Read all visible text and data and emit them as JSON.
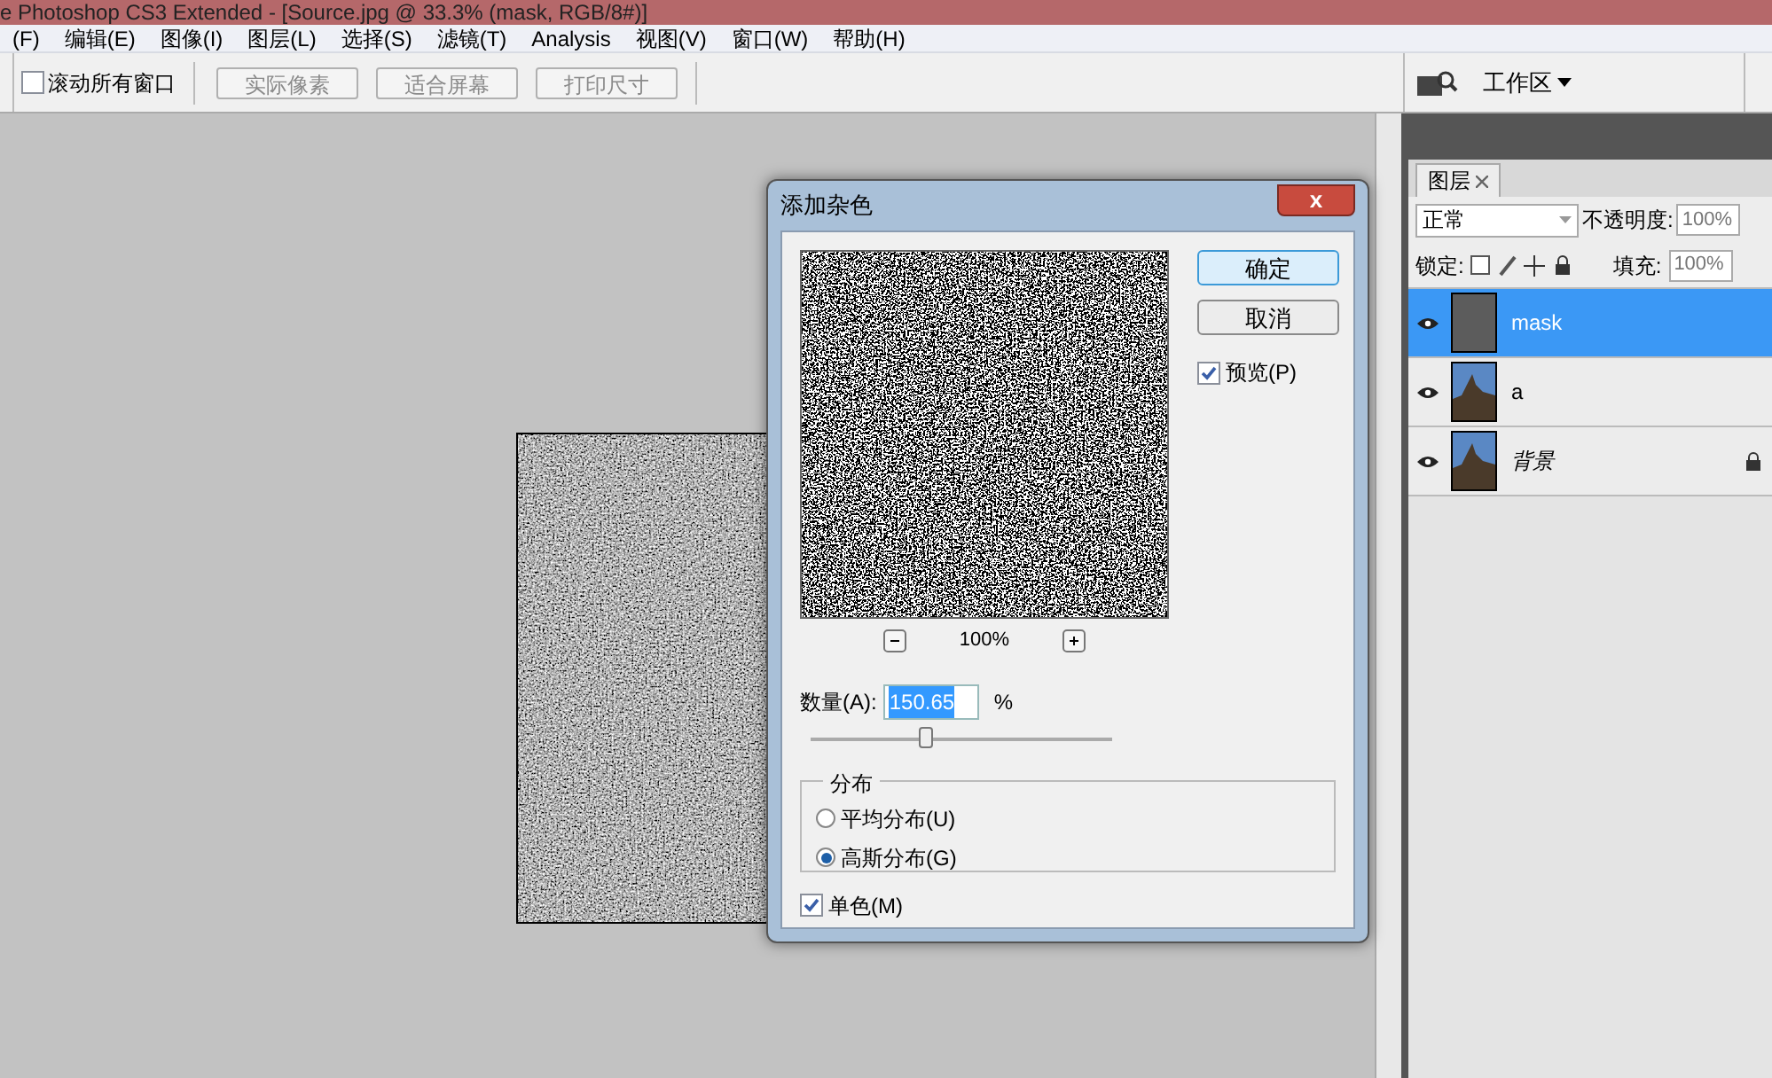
{
  "window": {
    "title": "e Photoshop CS3 Extended - [Source.jpg @ 33.3% (mask, RGB/8#)]"
  },
  "menu": [
    "(F)",
    "编辑(E)",
    "图像(I)",
    "图层(L)",
    "选择(S)",
    "滤镜(T)",
    "Analysis",
    "视图(V)",
    "窗口(W)",
    "帮助(H)"
  ],
  "options_bar": {
    "scroll_all": {
      "label": "滚动所有窗口",
      "checked": false
    },
    "buttons": [
      {
        "label": "实际像素",
        "disabled": true
      },
      {
        "label": "适合屏幕",
        "disabled": true
      },
      {
        "label": "打印尺寸",
        "disabled": true
      }
    ],
    "workspace": "工作区"
  },
  "dialog": {
    "title": "添加杂色",
    "close": "x",
    "ok": "确定",
    "cancel": "取消",
    "preview": {
      "label": "预览(P)",
      "checked": true
    },
    "zoom": "100%",
    "amount_label": "数量(A):",
    "amount": "150.65",
    "unit": "%",
    "amount_slider": {
      "level": 0.38
    },
    "distribution": {
      "title": "分布",
      "options": [
        {
          "label": "平均分布(U)",
          "selected": false
        },
        {
          "label": "高斯分布(G)",
          "selected": true
        }
      ]
    },
    "mono": {
      "label": "单色(M)",
      "checked": true
    }
  },
  "layers_panel": {
    "tab": "图层",
    "blend_mode": "正常",
    "opacity_label": "不透明度:",
    "opacity": "100%",
    "lock_label": "锁定:",
    "fill_label": "填充:",
    "fill": "100%",
    "layers": [
      {
        "name": "mask",
        "kind": "noise",
        "selected": true,
        "visible": true,
        "locked": false,
        "italic": false
      },
      {
        "name": "a",
        "kind": "photo",
        "selected": false,
        "visible": true,
        "locked": false,
        "italic": false
      },
      {
        "name": "背景",
        "kind": "photo",
        "selected": false,
        "visible": true,
        "locked": true,
        "italic": true
      }
    ]
  }
}
